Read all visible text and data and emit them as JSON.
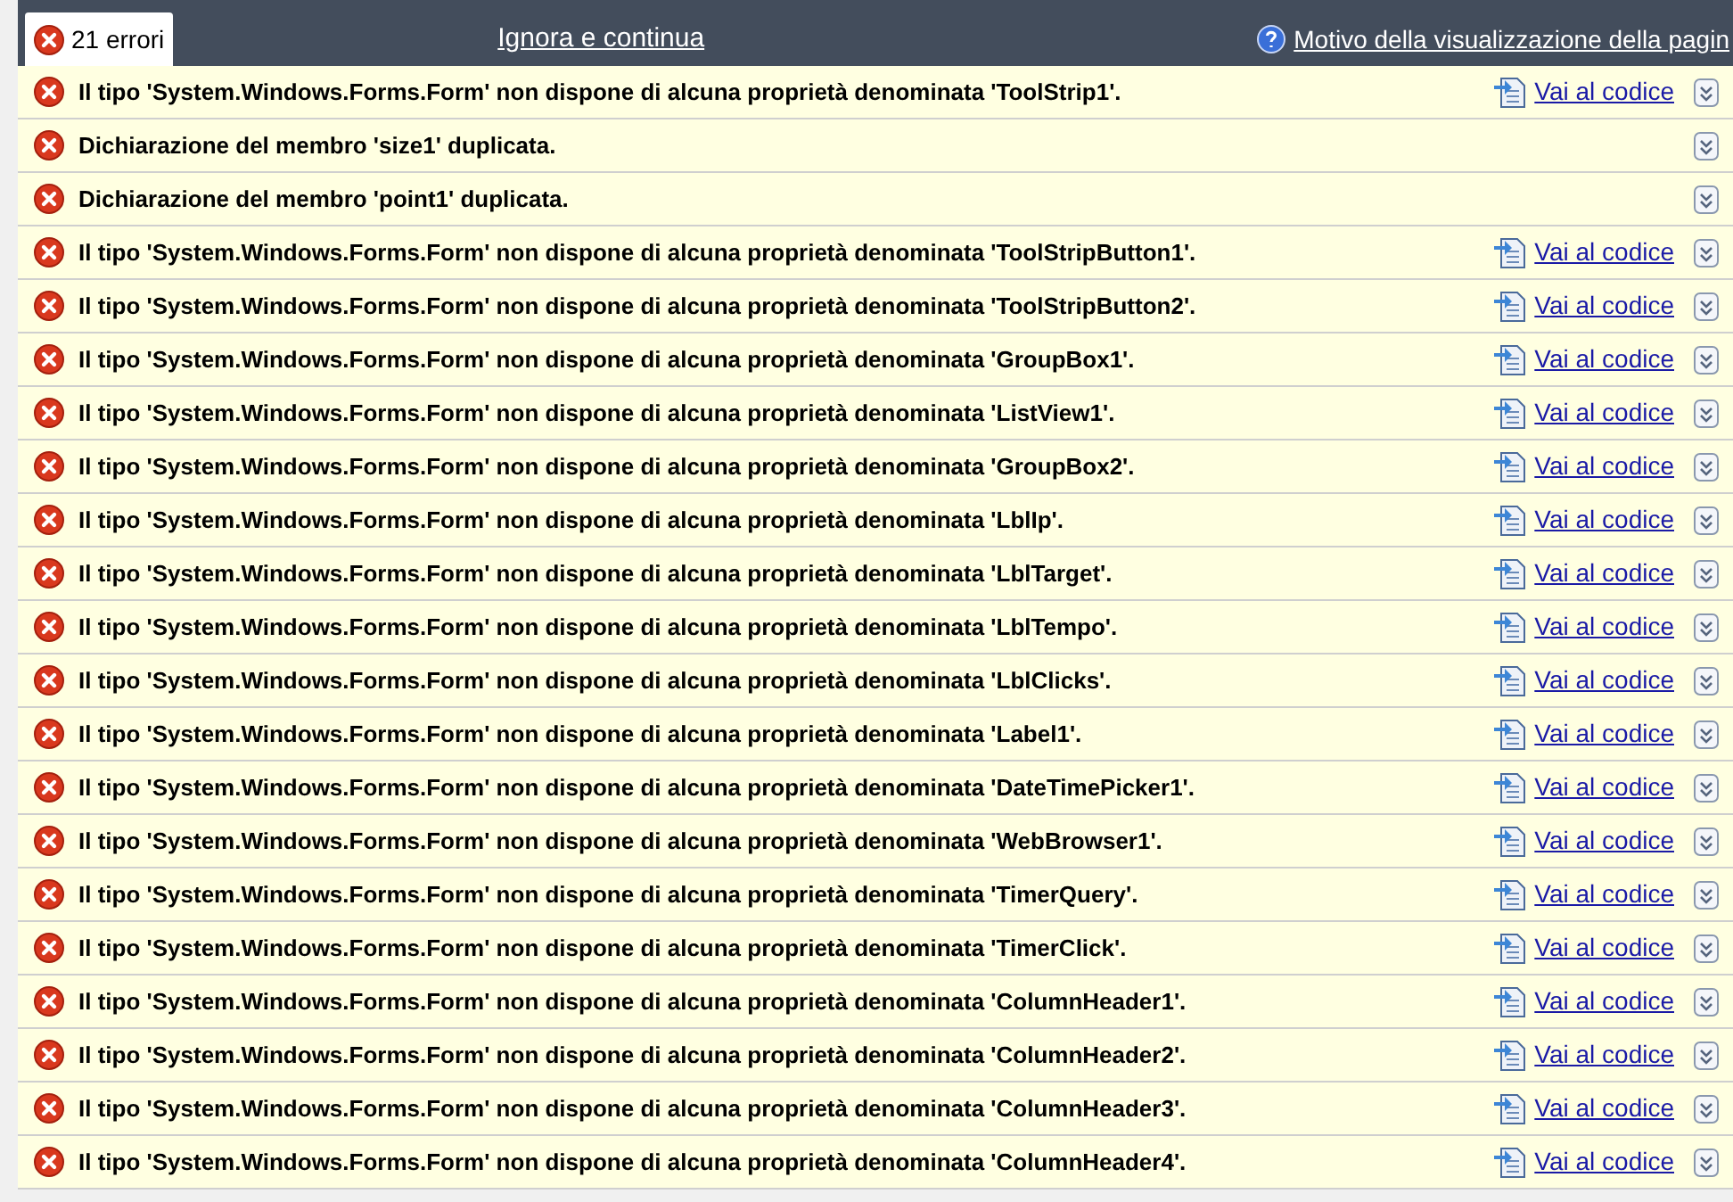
{
  "header": {
    "tab": {
      "label": "21 errori",
      "selected": true
    },
    "ignore_link": "Ignora e continua",
    "help_link": "Motivo della visualizzazione della pagin"
  },
  "errors": [
    {
      "message": "Il tipo 'System.Windows.Forms.Form' non dispone di alcuna proprietà denominata 'ToolStrip1'.",
      "link": "Vai al codice"
    },
    {
      "message": "Dichiarazione del membro 'size1' duplicata."
    },
    {
      "message": "Dichiarazione del membro 'point1' duplicata."
    },
    {
      "message": "Il tipo 'System.Windows.Forms.Form' non dispone di alcuna proprietà denominata 'ToolStripButton1'.",
      "link": "Vai al codice"
    },
    {
      "message": "Il tipo 'System.Windows.Forms.Form' non dispone di alcuna proprietà denominata 'ToolStripButton2'.",
      "link": "Vai al codice"
    },
    {
      "message": "Il tipo 'System.Windows.Forms.Form' non dispone di alcuna proprietà denominata 'GroupBox1'.",
      "link": "Vai al codice"
    },
    {
      "message": "Il tipo 'System.Windows.Forms.Form' non dispone di alcuna proprietà denominata 'ListView1'.",
      "link": "Vai al codice"
    },
    {
      "message": "Il tipo 'System.Windows.Forms.Form' non dispone di alcuna proprietà denominata 'GroupBox2'.",
      "link": "Vai al codice"
    },
    {
      "message": "Il tipo 'System.Windows.Forms.Form' non dispone di alcuna proprietà denominata 'LblIp'.",
      "link": "Vai al codice"
    },
    {
      "message": "Il tipo 'System.Windows.Forms.Form' non dispone di alcuna proprietà denominata 'LblTarget'.",
      "link": "Vai al codice"
    },
    {
      "message": "Il tipo 'System.Windows.Forms.Form' non dispone di alcuna proprietà denominata 'LblTempo'.",
      "link": "Vai al codice"
    },
    {
      "message": "Il tipo 'System.Windows.Forms.Form' non dispone di alcuna proprietà denominata 'LblClicks'.",
      "link": "Vai al codice"
    },
    {
      "message": "Il tipo 'System.Windows.Forms.Form' non dispone di alcuna proprietà denominata 'Label1'.",
      "link": "Vai al codice"
    },
    {
      "message": "Il tipo 'System.Windows.Forms.Form' non dispone di alcuna proprietà denominata 'DateTimePicker1'.",
      "link": "Vai al codice"
    },
    {
      "message": "Il tipo 'System.Windows.Forms.Form' non dispone di alcuna proprietà denominata 'WebBrowser1'.",
      "link": "Vai al codice"
    },
    {
      "message": "Il tipo 'System.Windows.Forms.Form' non dispone di alcuna proprietà denominata 'TimerQuery'.",
      "link": "Vai al codice"
    },
    {
      "message": "Il tipo 'System.Windows.Forms.Form' non dispone di alcuna proprietà denominata 'TimerClick'.",
      "link": "Vai al codice"
    },
    {
      "message": "Il tipo 'System.Windows.Forms.Form' non dispone di alcuna proprietà denominata 'ColumnHeader1'.",
      "link": "Vai al codice"
    },
    {
      "message": "Il tipo 'System.Windows.Forms.Form' non dispone di alcuna proprietà denominata 'ColumnHeader2'.",
      "link": "Vai al codice"
    },
    {
      "message": "Il tipo 'System.Windows.Forms.Form' non dispone di alcuna proprietà denominata 'ColumnHeader3'.",
      "link": "Vai al codice"
    },
    {
      "message": "Il tipo 'System.Windows.Forms.Form' non dispone di alcuna proprietà denominata 'ColumnHeader4'.",
      "link": "Vai al codice"
    }
  ]
}
